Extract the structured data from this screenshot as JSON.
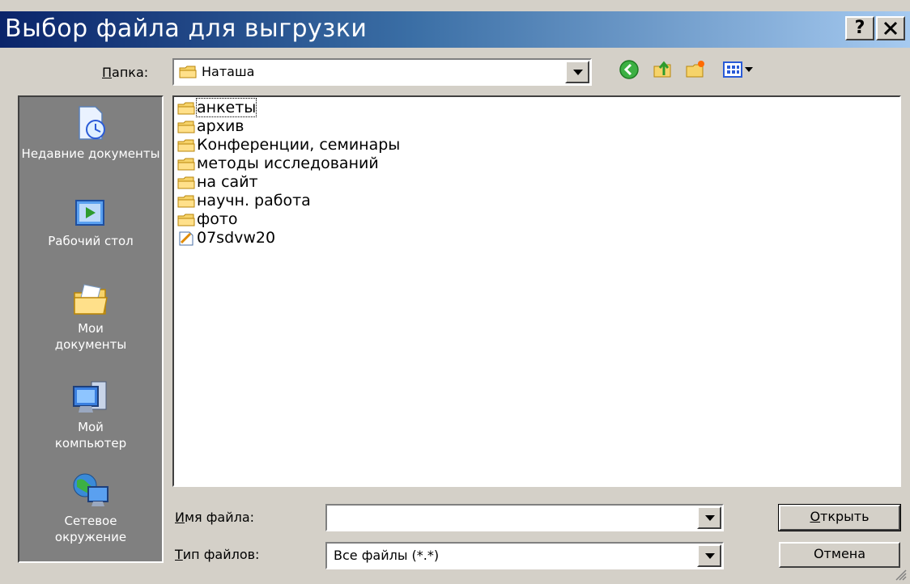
{
  "window": {
    "title": "Выбор файла для выгрузки",
    "help_label": "?",
    "close_label": "×"
  },
  "folder": {
    "label_underlined": "П",
    "label_rest": "апка:",
    "value": "Наташа"
  },
  "toolbar": {
    "back_icon": "back-arrow-icon",
    "up_icon": "up-folder-icon",
    "new_folder_icon": "new-folder-icon",
    "views_icon": "views-menu-icon"
  },
  "places": [
    {
      "label": "Недавние документы",
      "icon": "recent-documents-icon"
    },
    {
      "label": "Рабочий стол",
      "icon": "desktop-icon"
    },
    {
      "label": "Мои документы",
      "icon": "my-documents-icon"
    },
    {
      "label": "Мой компьютер",
      "icon": "my-computer-icon"
    },
    {
      "label": "Сетевое окружение",
      "icon": "network-icon"
    }
  ],
  "files": [
    {
      "name": "анкеты",
      "type": "folder"
    },
    {
      "name": "архив",
      "type": "folder"
    },
    {
      "name": "Конференции, семинары",
      "type": "folder"
    },
    {
      "name": "методы исследований",
      "type": "folder"
    },
    {
      "name": "на сайт",
      "type": "folder"
    },
    {
      "name": "научн. работа",
      "type": "folder"
    },
    {
      "name": "фото",
      "type": "folder"
    },
    {
      "name": "07sdvw20",
      "type": "file"
    }
  ],
  "filename": {
    "label_underlined": "И",
    "label_rest": "мя файла:",
    "value": ""
  },
  "filetype": {
    "label_underlined": "Т",
    "label_rest": "ип файлов:",
    "value": "Все файлы (*.*)"
  },
  "buttons": {
    "open_underlined": "О",
    "open_rest": "ткрыть",
    "cancel": "Отмена"
  },
  "colors": {
    "title_gradient_start": "#0a246a",
    "title_gradient_end": "#a6caf0",
    "face": "#d4d0c8",
    "places_bg": "#808080"
  }
}
